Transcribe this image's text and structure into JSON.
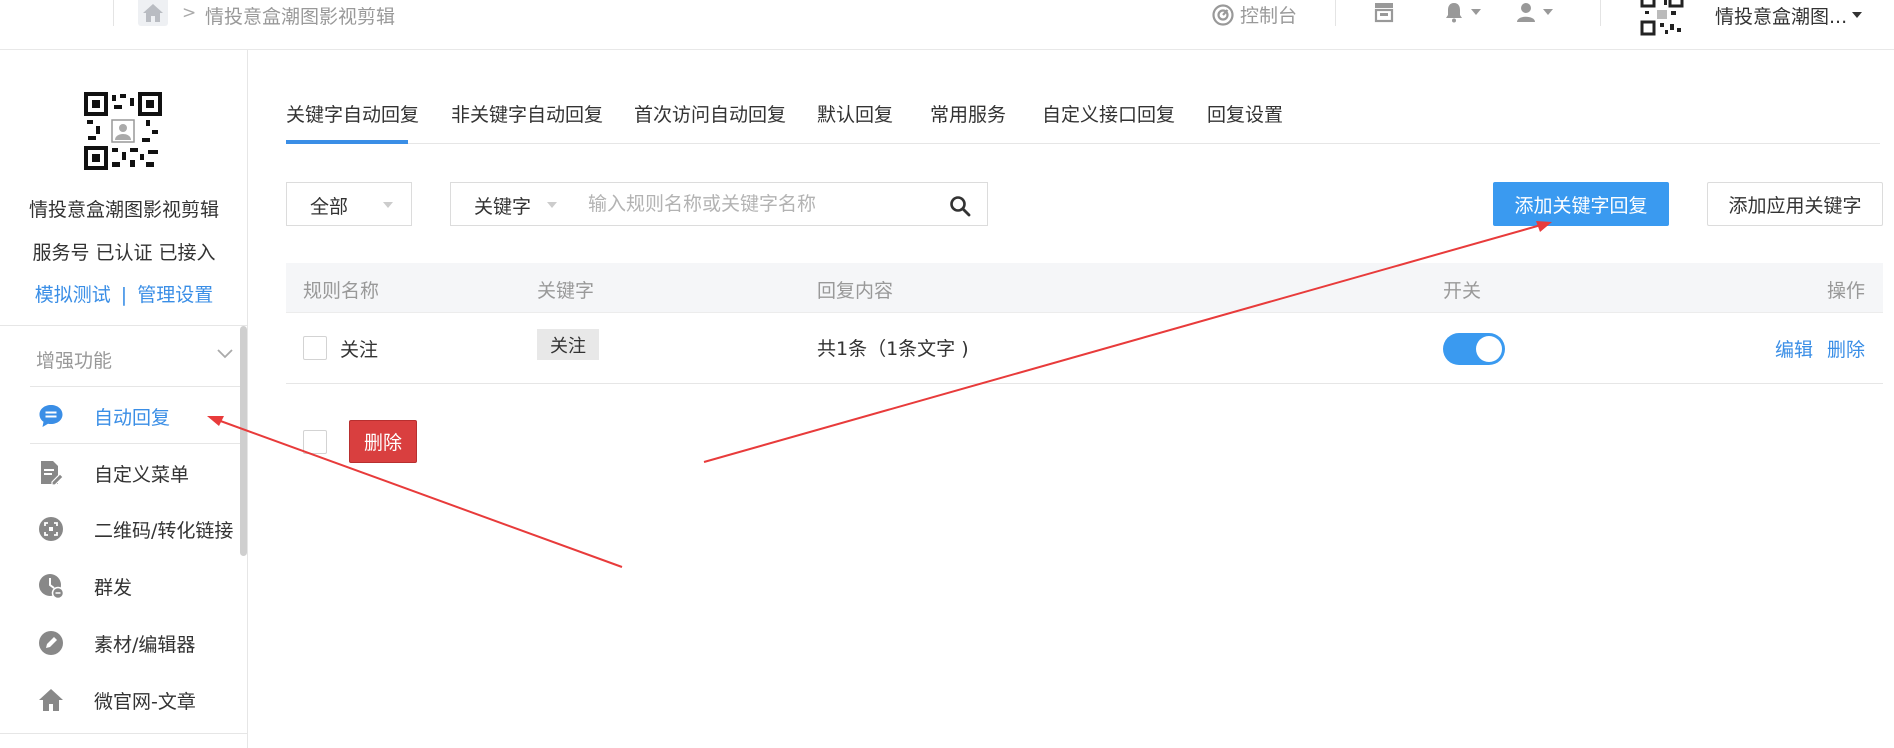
{
  "topbar": {
    "breadcrumb_current": "情投意盒潮图影视剪辑",
    "console_label": "控制台",
    "account_name": "情投意盒潮图...",
    "icons": [
      "home-icon",
      "speedometer-icon",
      "store-icon",
      "bell-icon",
      "user-icon"
    ]
  },
  "sidebar": {
    "account_title": "情投意盒潮图影视剪辑",
    "account_status": "服务号 已认证 已接入",
    "link_test": "模拟测试",
    "link_separator": "|",
    "link_manage": "管理设置",
    "section_title": "增强功能",
    "items": [
      {
        "label": "自动回复",
        "icon": "chat-bubble-icon",
        "active": true
      },
      {
        "label": "自定义菜单",
        "icon": "document-edit-icon",
        "active": false
      },
      {
        "label": "二维码/转化链接",
        "icon": "qr-scan-icon",
        "active": false
      },
      {
        "label": "群发",
        "icon": "clock-send-icon",
        "active": false
      },
      {
        "label": "素材/编辑器",
        "icon": "pencil-icon",
        "active": false
      },
      {
        "label": "微官网-文章",
        "icon": "house-icon",
        "active": false
      }
    ]
  },
  "tabs": [
    {
      "label": "关键字自动回复",
      "active": true
    },
    {
      "label": "非关键字自动回复",
      "active": false
    },
    {
      "label": "首次访问自动回复",
      "active": false
    },
    {
      "label": "默认回复",
      "active": false
    },
    {
      "label": "常用服务",
      "active": false
    },
    {
      "label": "自定义接口回复",
      "active": false
    },
    {
      "label": "回复设置",
      "active": false
    }
  ],
  "filters": {
    "scope_value": "全部",
    "type_value": "关键字",
    "search_placeholder": "输入规则名称或关键字名称"
  },
  "actions": {
    "add_keyword_reply": "添加关键字回复",
    "add_app_keyword": "添加应用关键字",
    "delete": "删除"
  },
  "table": {
    "headers": [
      "规则名称",
      "关键字",
      "回复内容",
      "开关",
      "操作"
    ],
    "rows": [
      {
        "rule_name": "关注",
        "keyword": "关注",
        "reply_content": "共1条（1条文字 )",
        "switch_on": true,
        "edit": "编辑",
        "delete": "删除"
      }
    ]
  },
  "colors": {
    "accent": "#3a9af0",
    "link": "#3a8ee6",
    "danger": "#d93f3f",
    "annotation_arrow": "#e83b3b"
  }
}
